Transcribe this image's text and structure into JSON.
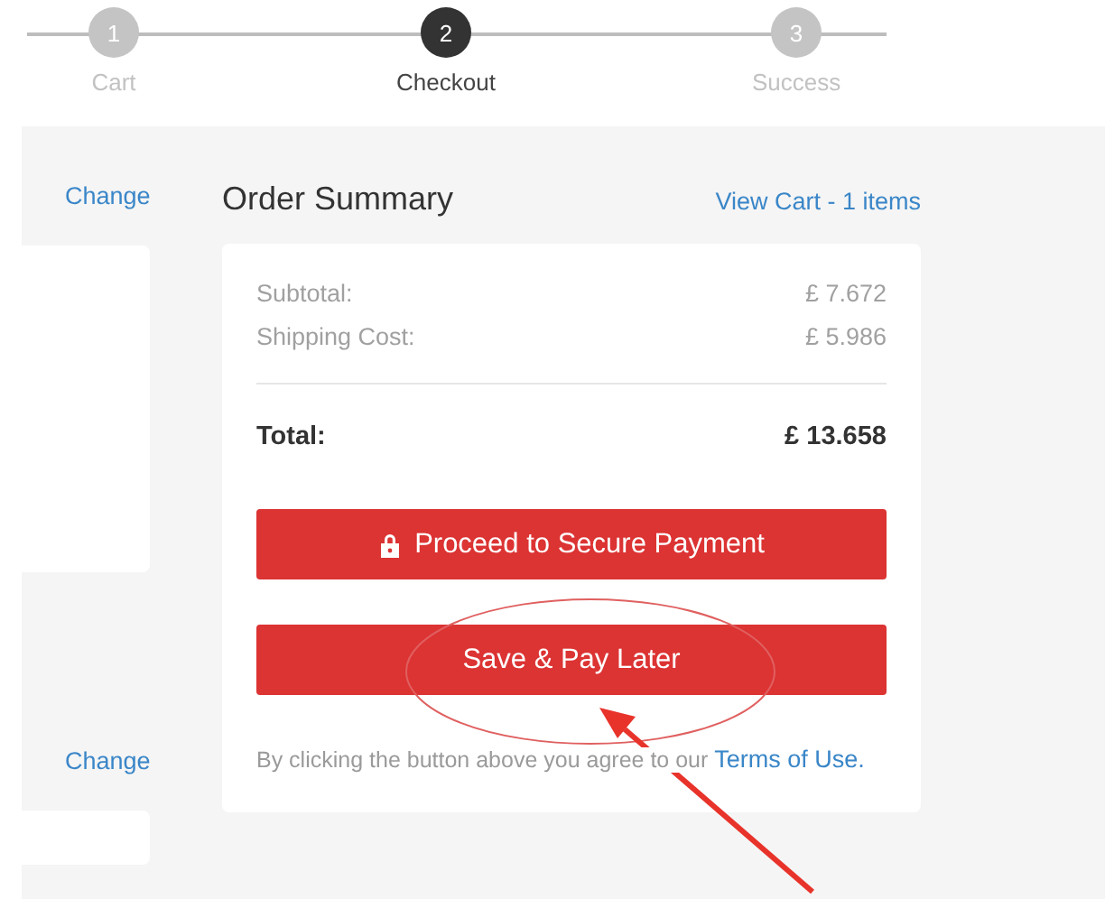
{
  "steps": [
    {
      "number": "1",
      "label": "Cart",
      "selected": false
    },
    {
      "number": "2",
      "label": "Checkout",
      "selected": true
    },
    {
      "number": "3",
      "label": "Success",
      "selected": false
    }
  ],
  "side_links": [
    "Change",
    "Change"
  ],
  "summary": {
    "title": "Order Summary",
    "cart_link": "View Cart - 1 items",
    "lines": [
      {
        "label": "Subtotal:",
        "value": "£ 7.672"
      },
      {
        "label": "Shipping Cost:",
        "value": "£ 5.986"
      }
    ],
    "total": {
      "label": "Total:",
      "value": "£ 13.658"
    },
    "buttons": [
      {
        "label": "Proceed to Secure Payment",
        "kind": "secure"
      },
      {
        "label": "Save & Pay Later",
        "kind": "plain"
      }
    ],
    "note": "By clicking the button above you agree to our",
    "terms_link": "Terms of Use."
  },
  "annotations": [
    {
      "kind": "ellipse"
    },
    {
      "kind": "arrow"
    }
  ]
}
